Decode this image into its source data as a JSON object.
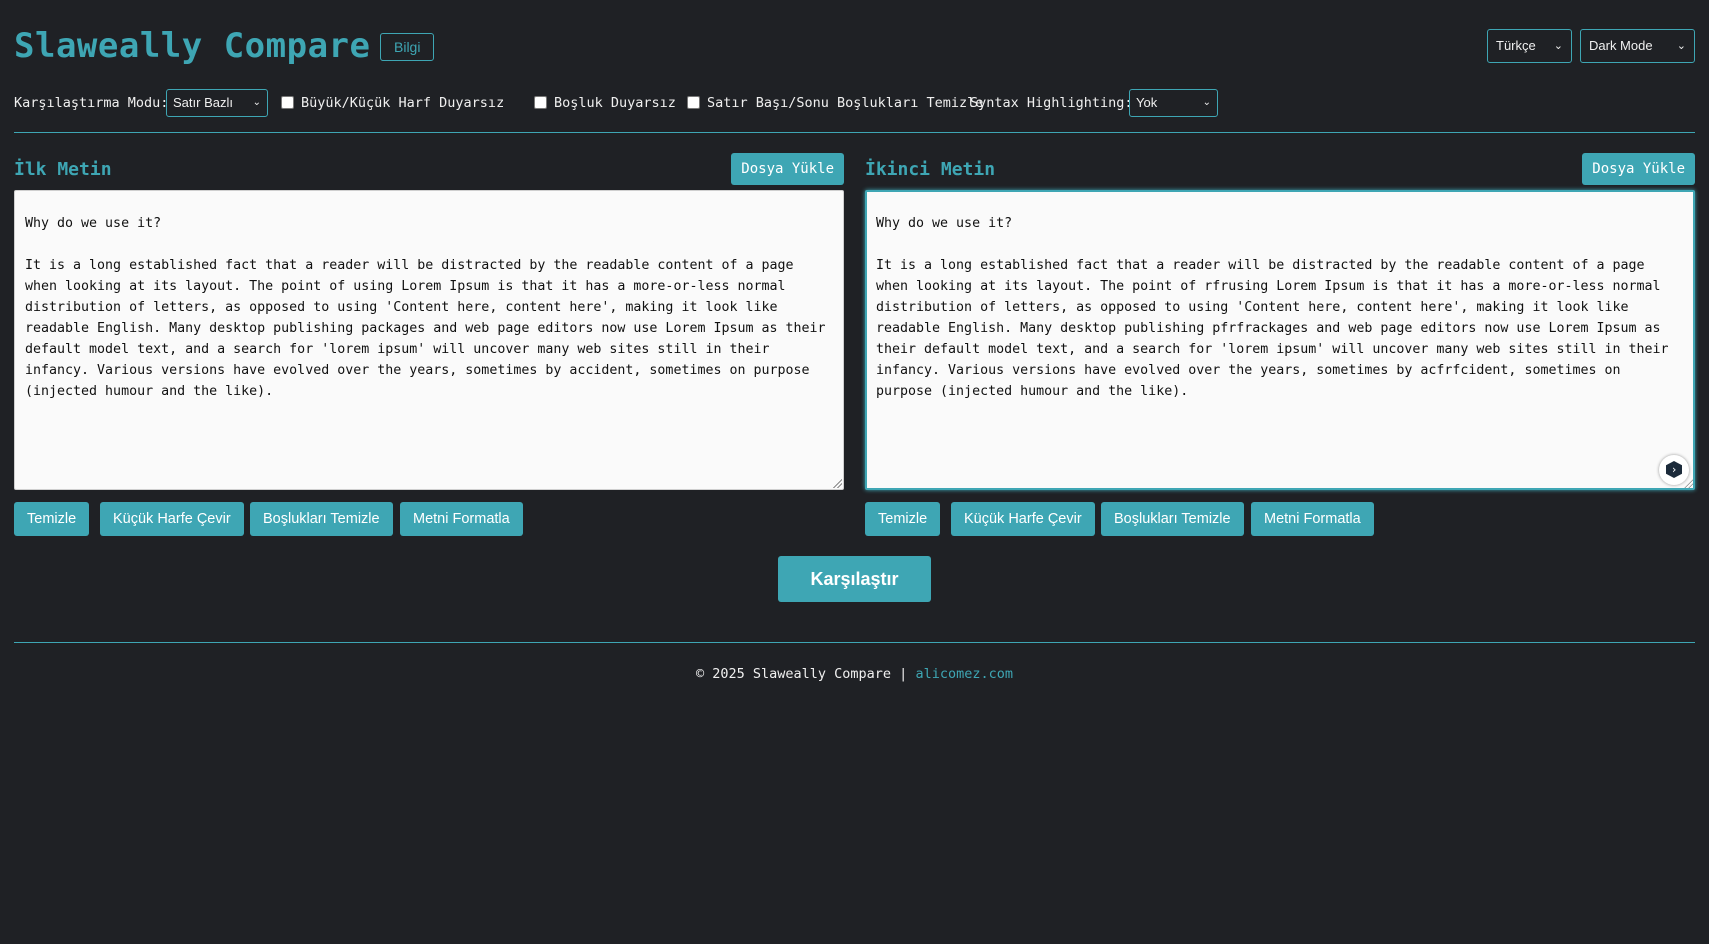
{
  "header": {
    "title": "Slaweally Compare",
    "info_label": "Bilgi",
    "language": "Türkçe",
    "theme": "Dark Mode"
  },
  "options": {
    "mode_label": "Karşılaştırma Modu:",
    "mode_value": "Satır Bazlı",
    "case_insensitive_label": "Büyük/Küçük Harf Duyarsız",
    "case_insensitive_checked": false,
    "whitespace_insensitive_label": "Boşluk Duyarsız",
    "whitespace_insensitive_checked": false,
    "trim_label": "Satır Başı/Sonu Boşlukları Temizle",
    "trim_checked": false,
    "syntax_label": "Syntax Highlighting:",
    "syntax_value": "Yok"
  },
  "left_panel": {
    "title": "İlk Metin",
    "upload_label": "Dosya Yükle",
    "text": "Why do we use it?\n\nIt is a long established fact that a reader will be distracted by the readable content of a page when looking at its layout. The point of using Lorem Ipsum is that it has a more-or-less normal distribution of letters, as opposed to using 'Content here, content here', making it look like readable English. Many desktop publishing packages and web page editors now use Lorem Ipsum as their default model text, and a search for 'lorem ipsum' will uncover many web sites still in their infancy. Various versions have evolved over the years, sometimes by accident, sometimes on purpose (injected humour and the like).",
    "buttons": [
      "Temizle",
      "Küçük Harfe Çevir",
      "Boşlukları Temizle",
      "Metni Formatla"
    ]
  },
  "right_panel": {
    "title": "İkinci Metin",
    "upload_label": "Dosya Yükle",
    "text": "Why do we use it?\n\nIt is a long established fact that a reader will be distracted by the readable content of a page when looking at its layout. The point of rfrusing Lorem Ipsum is that it has a more-or-less normal distribution of letters, as opposed to using 'Content here, content here', making it look like readable English. Many desktop publishing pfrfrackages and web page editors now use Lorem Ipsum as their default model text, and a search for 'lorem ipsum' will uncover many web sites still in their infancy. Various versions have evolved over the years, sometimes by acfrfcident, sometimes on purpose (injected humour and the like).",
    "buttons": [
      "Temizle",
      "Küçük Harfe Çevir",
      "Boşlukları Temizle",
      "Metni Formatla"
    ]
  },
  "compare_label": "Karşılaştır",
  "footer": {
    "text": "© 2025 Slaweally Compare |",
    "link": "alicomez.com"
  },
  "colors": {
    "accent": "#3ea6b4",
    "background": "#1f2125",
    "textarea_bg": "#fafafa"
  }
}
